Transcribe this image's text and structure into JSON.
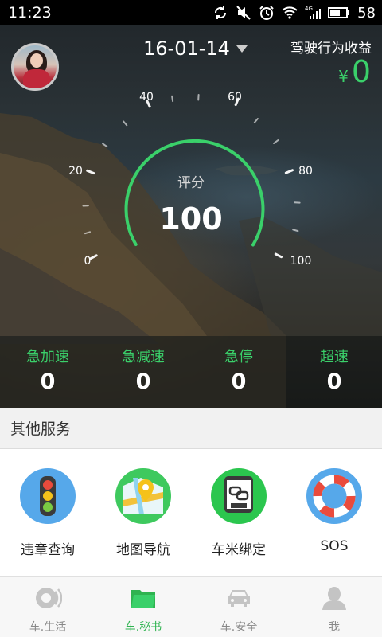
{
  "status_bar": {
    "time": "11:23",
    "network": "4G",
    "battery": "58",
    "icons": [
      "sync-icon",
      "mute-icon",
      "alarm-icon",
      "wifi-icon",
      "signal-icon",
      "battery-icon"
    ]
  },
  "header": {
    "date": "16-01-14",
    "earnings_title": "驾驶行为收益",
    "currency": "¥",
    "earnings_value": "0"
  },
  "gauge": {
    "score_label": "评分",
    "score": "100",
    "ticks": [
      "0",
      "20",
      "40",
      "60",
      "80",
      "100"
    ],
    "arc_color": "#3ad06a"
  },
  "stats": [
    {
      "label": "急加速",
      "value": "0"
    },
    {
      "label": "急减速",
      "value": "0"
    },
    {
      "label": "急停",
      "value": "0"
    },
    {
      "label": "超速",
      "value": "0"
    }
  ],
  "services": {
    "title": "其他服务",
    "items": [
      {
        "label": "违章查询",
        "icon": "traffic-light-icon"
      },
      {
        "label": "地图导航",
        "icon": "map-pin-icon"
      },
      {
        "label": "车米绑定",
        "icon": "device-link-icon"
      },
      {
        "label": "SOS",
        "icon": "lifebuoy-icon"
      }
    ]
  },
  "tabs": [
    {
      "label": "车.生活",
      "icon": "car-life-icon",
      "active": false
    },
    {
      "label": "车.秘书",
      "icon": "folder-icon",
      "active": true
    },
    {
      "label": "车.安全",
      "icon": "car-icon",
      "active": false
    },
    {
      "label": "我",
      "icon": "person-icon",
      "active": false
    }
  ],
  "colors": {
    "accent": "#3ad06a",
    "tab_active": "#2fb350"
  }
}
